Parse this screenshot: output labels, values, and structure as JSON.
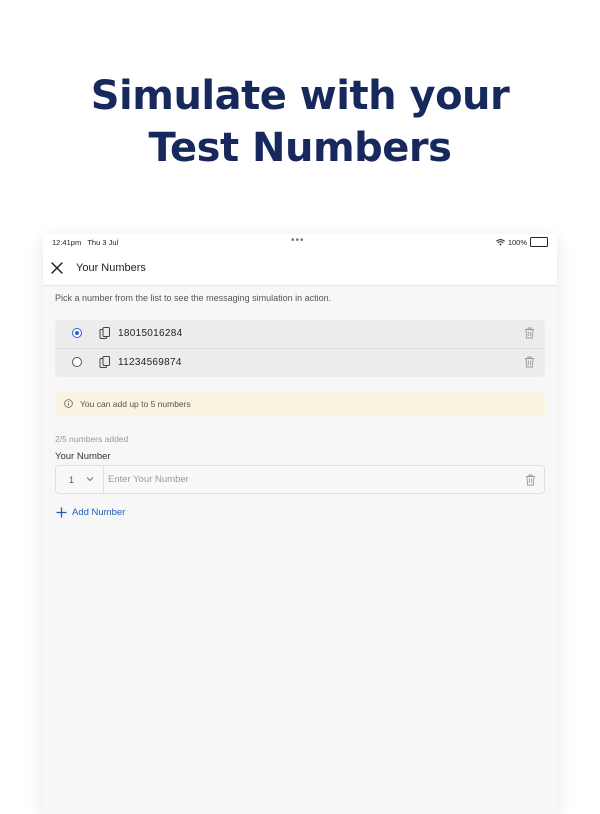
{
  "headline": {
    "line1": "Simulate with your",
    "line2": "Test Numbers"
  },
  "status_bar": {
    "time": "12:41pm",
    "date": "Thu 3 Jul",
    "battery": "100%"
  },
  "nav": {
    "title": "Your Numbers",
    "close_icon": "close-icon"
  },
  "intro_text": "Pick a number from the list to see the messaging simulation in action.",
  "numbers": [
    {
      "value": "18015016284",
      "selected": true
    },
    {
      "value": "11234569874",
      "selected": false
    }
  ],
  "info_banner": {
    "icon": "info-icon",
    "text": "You can add up to 5 numbers"
  },
  "numbers_count": "2/5 numbers added",
  "field": {
    "label": "Your Number",
    "country_code": "1",
    "placeholder": "Enter Your Number",
    "value": ""
  },
  "add_button": {
    "label": "Add Number",
    "icon": "plus-icon"
  },
  "colors": {
    "headline": "#17285c",
    "accent": "#2463d9",
    "link": "#1d5fb8",
    "banner_bg": "#faf3df",
    "card_bg": "#ececec"
  }
}
